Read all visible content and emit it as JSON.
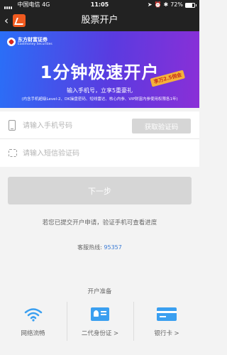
{
  "status_bar": {
    "carrier": "中国电信",
    "network": "4G",
    "time": "11:05",
    "battery": "72%",
    "battery_level": 0.72
  },
  "nav": {
    "back_icon": "chevron-left-icon",
    "title": "股票开户"
  },
  "banner": {
    "brand_name": "东方财富证券",
    "brand_en": "Eastmoney Securities",
    "ribbon": "享万2.5佣金",
    "headline": "1分钟极速开户",
    "subtitle": "输入手机号，立享5重豪礼",
    "subtitle_detail": "(内含手机超级Level-2、DK操盘密码、短线雷达、核心内参、VIP财富内参使用权限各1年)",
    "gradient_colors": [
      "#2a6ff7",
      "#5a3be0",
      "#8a2fd7"
    ]
  },
  "form": {
    "phone_placeholder": "请输入手机号码",
    "code_placeholder": "请输入短信验证码",
    "get_code_label": "获取验证码"
  },
  "next_label": "下一步",
  "progress_text": "若您已提交开户申请，验证手机可查看进度",
  "hotline": {
    "label": "客服热线: ",
    "number": "95357"
  },
  "prep": {
    "title": "开户准备",
    "items": [
      {
        "label": "网络流畅",
        "icon": "wifi-icon"
      },
      {
        "label": "二代身份证 >",
        "icon": "id-card-icon"
      },
      {
        "label": "银行卡 >",
        "icon": "bank-card-icon"
      }
    ]
  },
  "colors": {
    "accent_blue": "#3a9ff0",
    "link_blue": "#3a7bd5",
    "button_disabled": "#d6d6d6",
    "app_orange": "#f05a1f"
  }
}
